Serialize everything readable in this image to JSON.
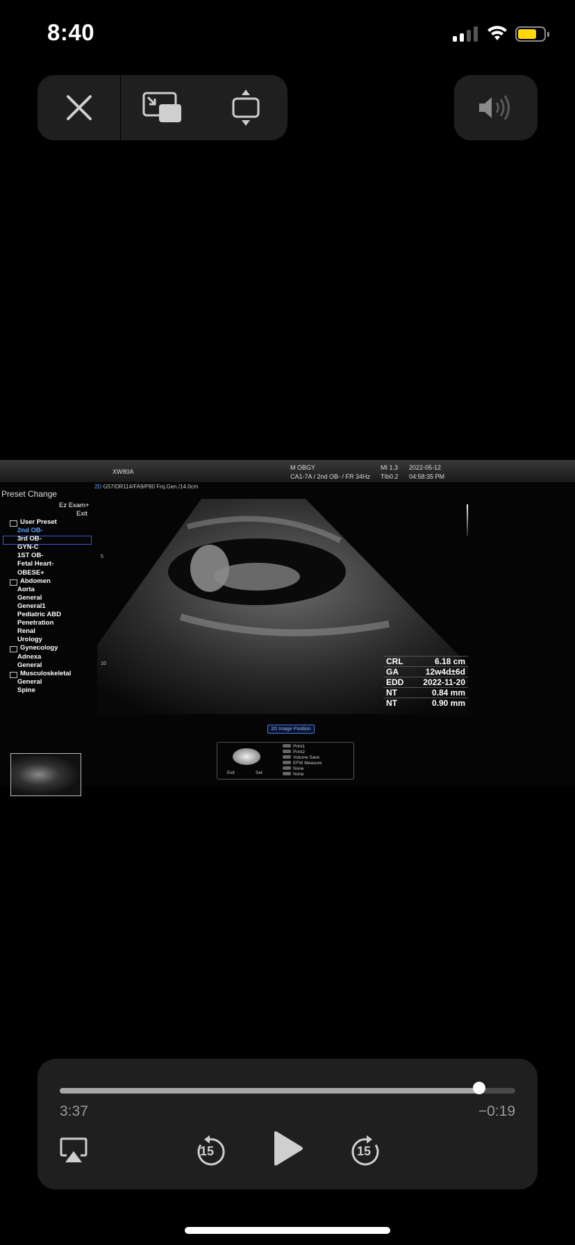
{
  "status_bar": {
    "time": "8:40",
    "battery_color": "#ffd60a"
  },
  "top_controls": {
    "close_icon": "close-icon",
    "pip_icon": "picture-in-picture-icon",
    "resize_icon": "resize-icon",
    "volume_icon": "speaker-icon"
  },
  "ultrasound": {
    "model": "XW80A",
    "mode": "M OBGY",
    "probe": "CA1-7A / 2nd OB- / FR 34Hz",
    "mi": "MI  1.3",
    "tib": "TIb0.2",
    "date": "2022-05-12",
    "clock": "04:58:35 PM",
    "subheader_mode": "2D",
    "subheader": "G57/DR114/FA9/P80 Frq.Gen./14.0cm",
    "preset_title": "Preset Change",
    "ez_exam": "Ez Exam+",
    "exit": "Exit",
    "user_preset": "User Preset",
    "items": [
      {
        "label": "2nd OB-",
        "type": "item",
        "selected": true
      },
      {
        "label": "3rd OB-",
        "type": "item"
      },
      {
        "label": "GYN-C",
        "type": "item"
      },
      {
        "label": "1ST OB-",
        "type": "item"
      },
      {
        "label": "Fetal Heart-",
        "type": "item"
      },
      {
        "label": "OBESE+",
        "type": "item"
      },
      {
        "label": "Abdomen",
        "type": "category"
      },
      {
        "label": "Aorta",
        "type": "item"
      },
      {
        "label": "General",
        "type": "item"
      },
      {
        "label": "General1",
        "type": "item"
      },
      {
        "label": "Pediatric ABD",
        "type": "item"
      },
      {
        "label": "Penetration",
        "type": "item"
      },
      {
        "label": "Renal",
        "type": "item"
      },
      {
        "label": "Urology",
        "type": "item"
      },
      {
        "label": "Gynecology",
        "type": "category"
      },
      {
        "label": "Adnexa",
        "type": "item"
      },
      {
        "label": "General",
        "type": "item"
      },
      {
        "label": "Musculoskeletal",
        "type": "category"
      },
      {
        "label": "General",
        "type": "item"
      },
      {
        "label": "Spine",
        "type": "item"
      }
    ],
    "depth_5": "5",
    "depth_10": "10",
    "measurements": [
      {
        "label": "CRL",
        "value": "6.18 cm"
      },
      {
        "label": "GA",
        "value": "12w4d±6d"
      },
      {
        "label": "EDD",
        "value": "2022-11-20"
      },
      {
        "label": "NT",
        "value": "0.84 mm"
      },
      {
        "label": "NT",
        "value": "0.90 mm"
      }
    ],
    "image_position_button": "2D Image Position",
    "panel": {
      "exit": "Exit",
      "set": "Set",
      "list": [
        "Print1",
        "Print2",
        "Volume Save",
        "EFW Measure",
        "None",
        "None"
      ]
    }
  },
  "player": {
    "elapsed": "3:37",
    "remaining": "−0:19",
    "progress": 0.92,
    "skip_back": "15",
    "skip_forward": "15"
  }
}
